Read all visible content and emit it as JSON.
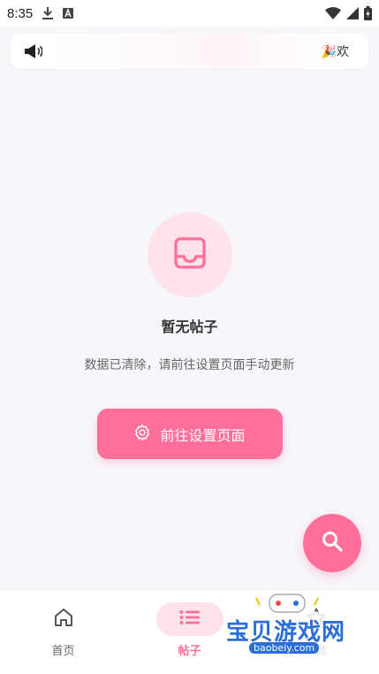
{
  "status_bar": {
    "time": "8:35",
    "icons_left": [
      "download-icon",
      "a-notification-icon"
    ],
    "icons_right": [
      "wifi-icon",
      "signal-icon",
      "battery-charging-icon"
    ]
  },
  "announcement": {
    "icon": "megaphone-icon",
    "text": "🎉欢"
  },
  "empty_state": {
    "icon": "inbox-icon",
    "title": "暂无帖子",
    "description": "数据已清除，请前往设置页面手动更新",
    "button_label": "前往设置页面",
    "button_icon": "gear-icon"
  },
  "fab": {
    "icon": "search-icon"
  },
  "bottom_nav": {
    "items": [
      {
        "label": "首页",
        "icon": "home-icon",
        "active": false
      },
      {
        "label": "帖子",
        "icon": "list-icon",
        "active": true
      },
      {
        "label": "收藏",
        "icon": "star-icon",
        "active": false
      }
    ]
  },
  "watermark": {
    "text": "宝贝游戏网",
    "url": "baobeiy.com"
  },
  "colors": {
    "accent": "#ff6f9a",
    "accent_light": "#ffe3ea",
    "background": "#f7f7fb"
  }
}
